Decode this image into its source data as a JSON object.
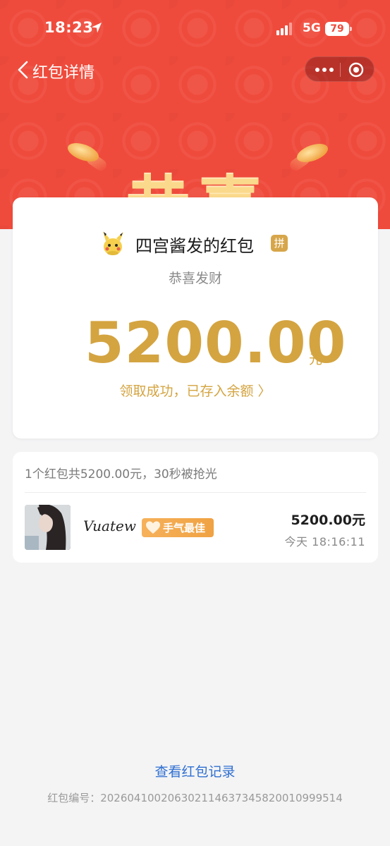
{
  "status_bar": {
    "time": "18:23",
    "network": "5G",
    "battery": "79"
  },
  "nav": {
    "title": "红包详情"
  },
  "hero": {
    "greeting": "恭喜"
  },
  "packet": {
    "sender_title": "四宫酱发的红包",
    "pin_badge": "拼",
    "blessing": "恭喜发财",
    "amount": "5200.00",
    "unit": "元",
    "receive_link": "领取成功，已存入余额 〉"
  },
  "records": {
    "summary": "1个红包共5200.00元，30秒被抢光",
    "items": [
      {
        "name": "Vuatew",
        "badge": "手气最佳",
        "amount": "5200.00元",
        "time": "今天  18:16:11"
      }
    ]
  },
  "footer": {
    "records_link": "查看红包记录",
    "serial": "红包编号：20260410020630211463734582001099951​4"
  },
  "colors": {
    "hero_red": "#ef4b3c",
    "gold": "#d4a441",
    "link_blue": "#2f6fd1",
    "badge_orange": "#f0a243"
  }
}
